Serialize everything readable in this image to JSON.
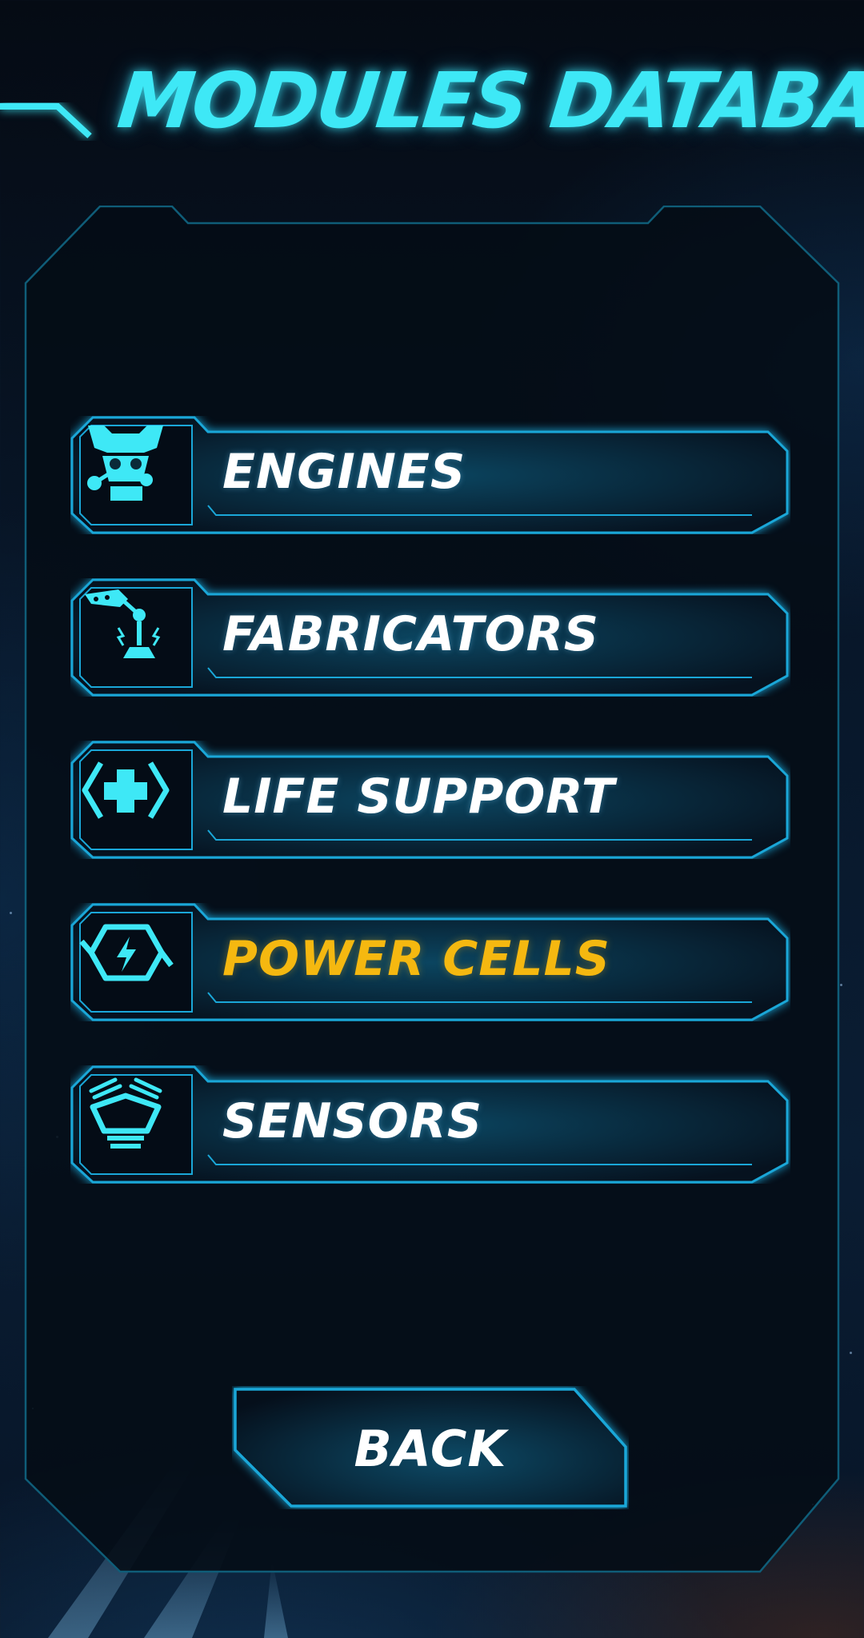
{
  "screen": {
    "title": "MODULES DATABASE",
    "accent_color": "#3ee8f6",
    "highlight_color": "#f5b810"
  },
  "menu": {
    "items": [
      {
        "label": "ENGINES",
        "icon": "engine-icon",
        "selected": false
      },
      {
        "label": "FABRICATORS",
        "icon": "robotic-arm-icon",
        "selected": false
      },
      {
        "label": "LIFE SUPPORT",
        "icon": "medical-cross-icon",
        "selected": false
      },
      {
        "label": "POWER CELLS",
        "icon": "lightning-battery-icon",
        "selected": true
      },
      {
        "label": "SENSORS",
        "icon": "sensor-array-icon",
        "selected": false
      }
    ]
  },
  "back_button": {
    "label": "BACK"
  }
}
